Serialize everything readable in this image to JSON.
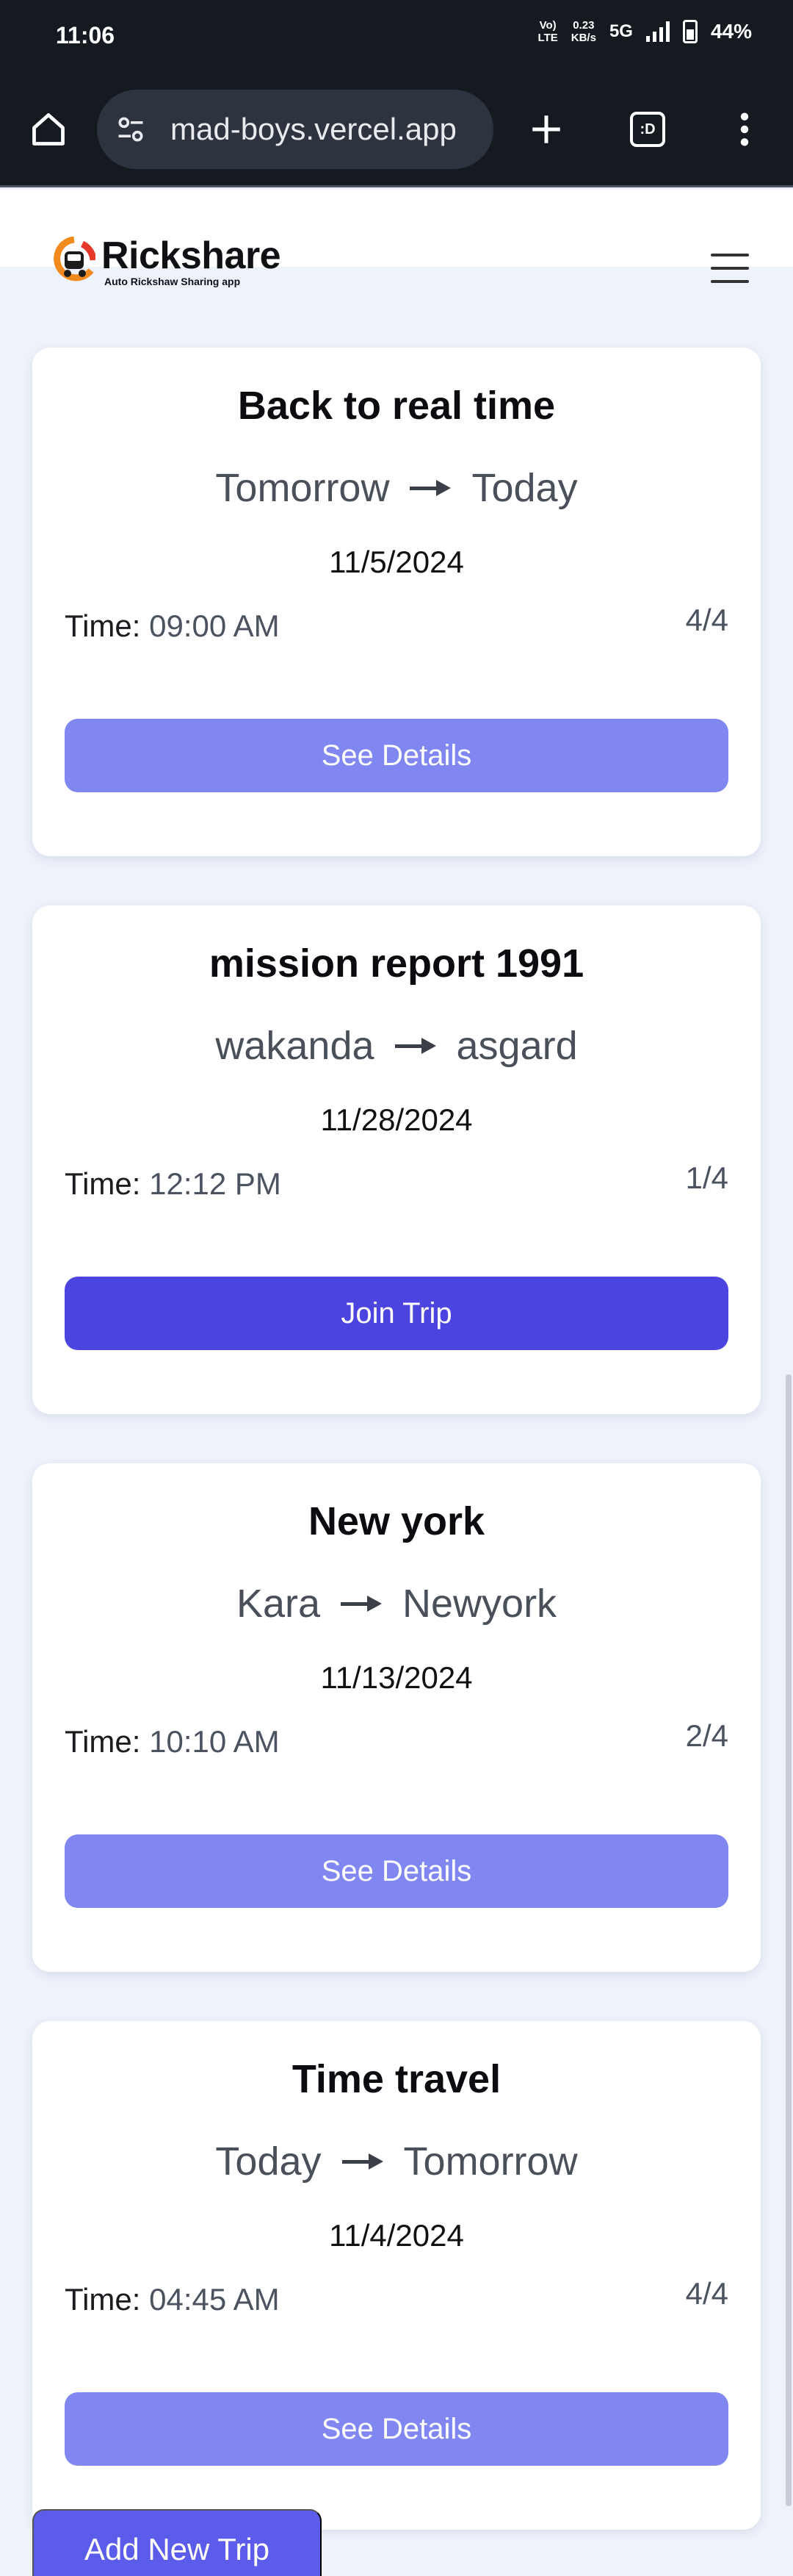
{
  "status_bar": {
    "time": "11:06",
    "volte": "Vo) LTE",
    "speed_value": "0.23",
    "speed_unit": "KB/s",
    "network": "5G",
    "battery": "44%"
  },
  "browser": {
    "url": "mad-boys.vercel.app",
    "tabs_label": ":D",
    "icons": [
      "home-icon",
      "site-settings-icon",
      "new-tab-icon",
      "tabs-icon",
      "more-menu-icon"
    ]
  },
  "header": {
    "logo_name": "Rickshare",
    "logo_tagline": "Auto Rickshaw Sharing app",
    "menu_icon": "hamburger-menu-icon"
  },
  "trips": [
    {
      "title": "Back to real time",
      "from": "Tomorrow",
      "to": "Today",
      "date": "11/5/2024",
      "time_label": "Time:",
      "time": "09:00 AM",
      "seats": "4/4",
      "action": "See Details"
    },
    {
      "title": "mission report 1991",
      "from": "wakanda",
      "to": "asgard",
      "date": "11/28/2024",
      "time_label": "Time:",
      "time": "12:12 PM",
      "seats": "1/4",
      "action": "Join Trip"
    },
    {
      "title": "New york",
      "from": "Kara",
      "to": "Newyork",
      "date": "11/13/2024",
      "time_label": "Time:",
      "time": "10:10 AM",
      "seats": "2/4",
      "action": "See Details"
    },
    {
      "title": "Time travel",
      "from": "Today",
      "to": "Tomorrow",
      "date": "11/4/2024",
      "time_label": "Time:",
      "time": "04:45 AM",
      "seats": "4/4",
      "action": "See Details"
    }
  ],
  "add_trip_label": "Add New Trip",
  "colors": {
    "see_details": "#8187f0",
    "join_trip": "#4c44df",
    "add_button": "#5b5cea",
    "page_bg": "#eef2fb",
    "status_bg": "#151a21"
  }
}
